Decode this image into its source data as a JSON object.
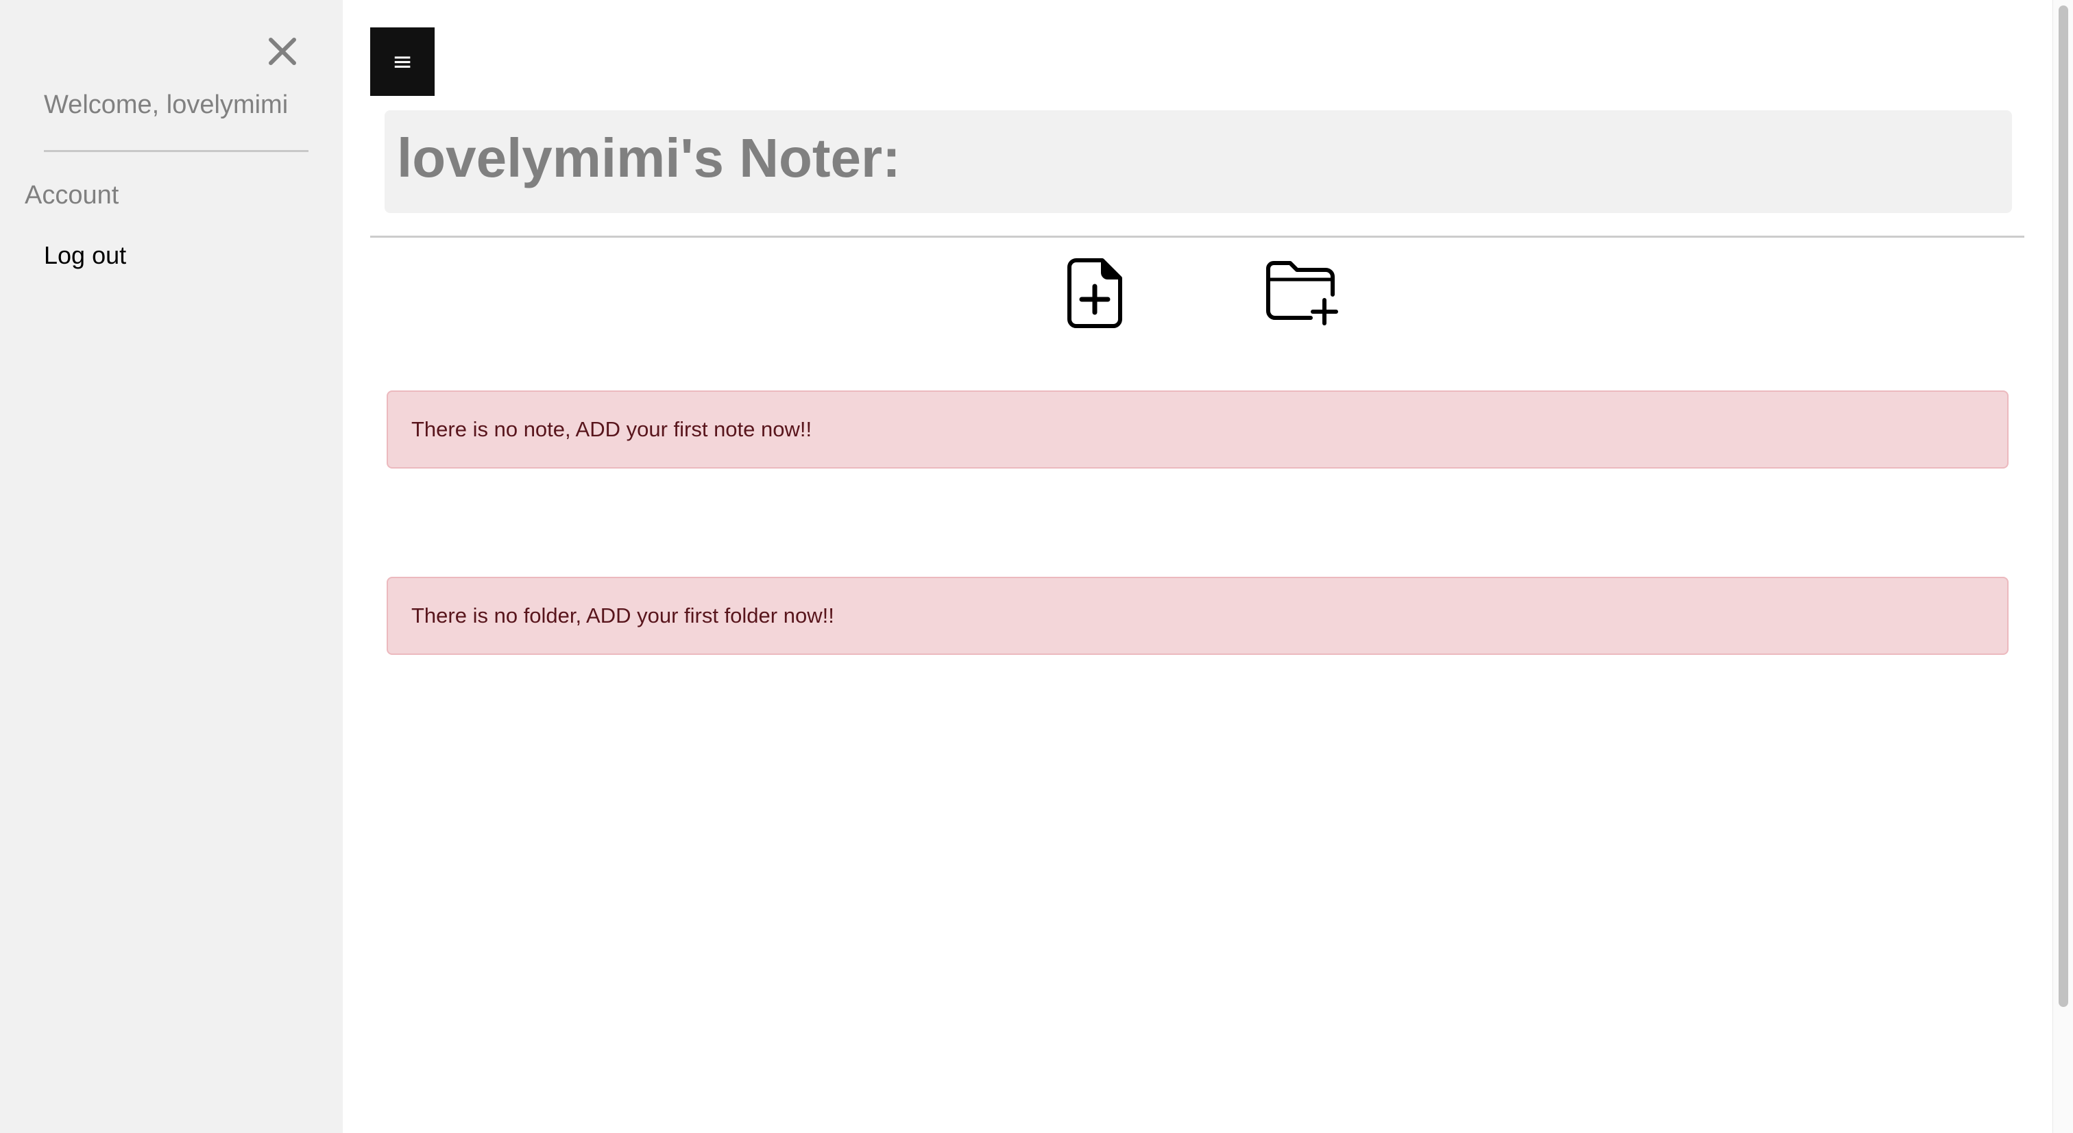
{
  "sidebar": {
    "close_icon": "close-icon",
    "welcome": "Welcome, lovelymimi",
    "section_title": "Account",
    "logout_label": "Log out"
  },
  "header": {
    "menu_glyph": "≡",
    "menu_icon": "hamburger-menu-icon",
    "title": "lovelymimi's Noter:"
  },
  "actions": {
    "add_note_icon": "file-plus-icon",
    "add_folder_icon": "folder-plus-icon"
  },
  "alerts": {
    "notes": "There is no note, ADD your first note now!!",
    "folders": "There is no folder, ADD your first folder now!!"
  },
  "colors": {
    "sidebar_bg": "#f1f1f1",
    "alert_bg": "#f3d6d9",
    "alert_border": "#ecb9be",
    "alert_text": "#58151c",
    "menu_button_bg": "#111111"
  }
}
